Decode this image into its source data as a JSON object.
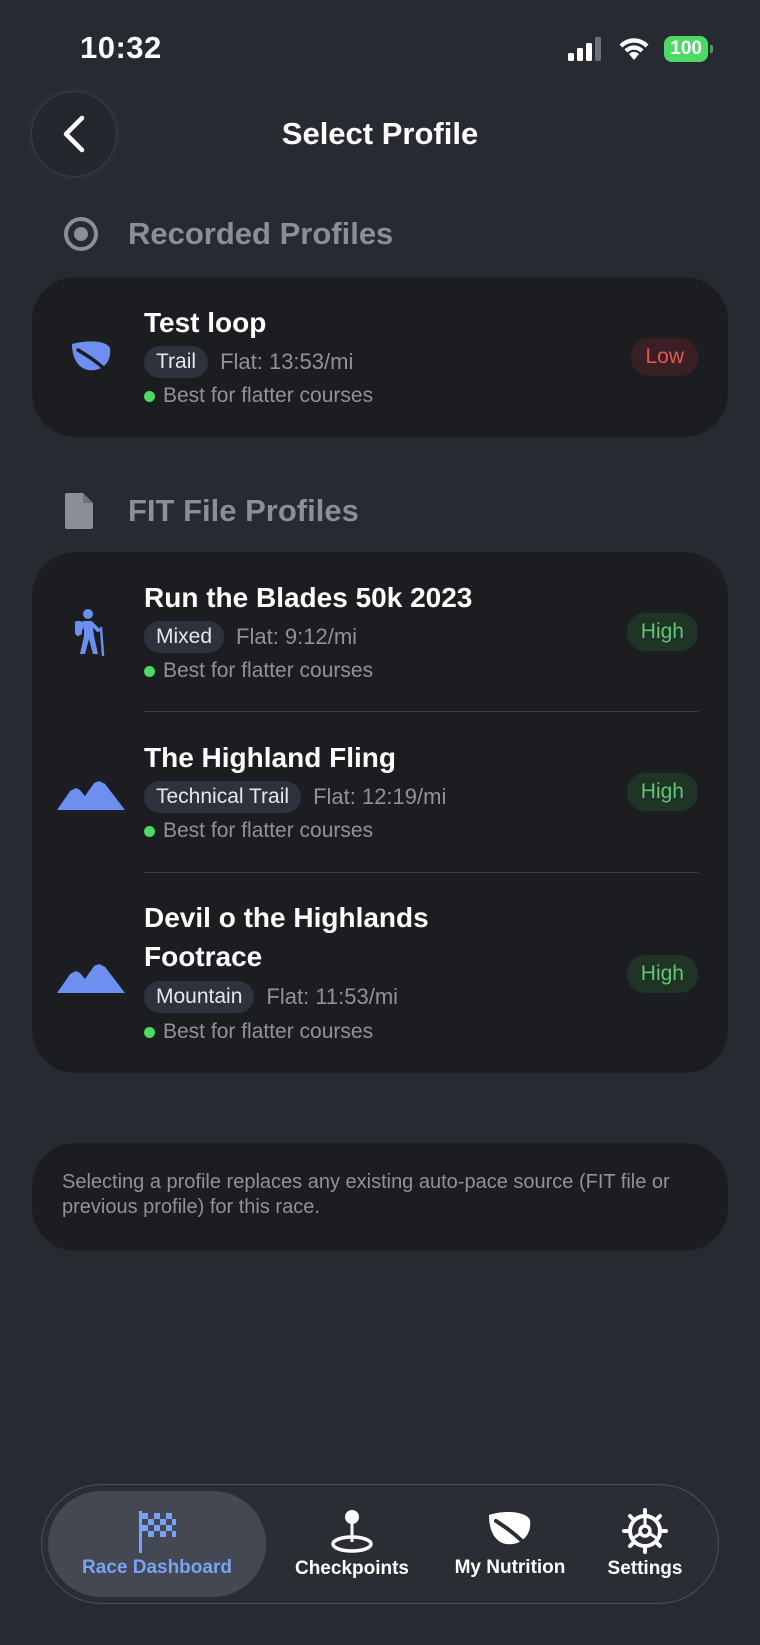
{
  "status_bar": {
    "time": "10:32",
    "battery": "100"
  },
  "header": {
    "title": "Select Profile"
  },
  "recorded_section": {
    "label": "Recorded Profiles",
    "items": [
      {
        "title": "Test loop",
        "tag": "Trail",
        "pace": "Flat: 13:53/mi",
        "note": "Best for flatter courses",
        "confidence": "Low",
        "icon": "leaf-icon"
      }
    ]
  },
  "fit_section": {
    "label": "FIT File Profiles",
    "items": [
      {
        "title": "Run the Blades 50k 2023",
        "tag": "Mixed",
        "pace": "Flat: 9:12/mi",
        "note": "Best for flatter courses",
        "confidence": "High",
        "icon": "hiker-icon"
      },
      {
        "title": "The Highland Fling",
        "tag": "Technical Trail",
        "pace": "Flat: 12:19/mi",
        "note": "Best for flatter courses",
        "confidence": "High",
        "icon": "mountain-icon"
      },
      {
        "title_line1": "Devil o the Highlands",
        "title_line2": "Footrace",
        "tag": "Mountain",
        "pace": "Flat: 11:53/mi",
        "note": "Best for flatter courses",
        "confidence": "High",
        "icon": "mountain-icon"
      }
    ]
  },
  "info": {
    "text": "Selecting a profile replaces any existing auto-pace source (FIT file or previous profile) for this race."
  },
  "tabbar": {
    "items": [
      {
        "label": "Race Dashboard",
        "icon": "checkered-flag-icon",
        "active": true
      },
      {
        "label": "Checkpoints",
        "icon": "map-pin-icon",
        "active": false
      },
      {
        "label": "My Nutrition",
        "icon": "leaf-icon",
        "active": false
      },
      {
        "label": "Settings",
        "icon": "gear-icon",
        "active": false
      }
    ]
  },
  "colors": {
    "background": "#272a30",
    "card": "#1c1d21",
    "accent": "#7aa2f7",
    "icon_blue": "#6c8ff0",
    "high": "#5ec870",
    "low": "#e05a55"
  }
}
